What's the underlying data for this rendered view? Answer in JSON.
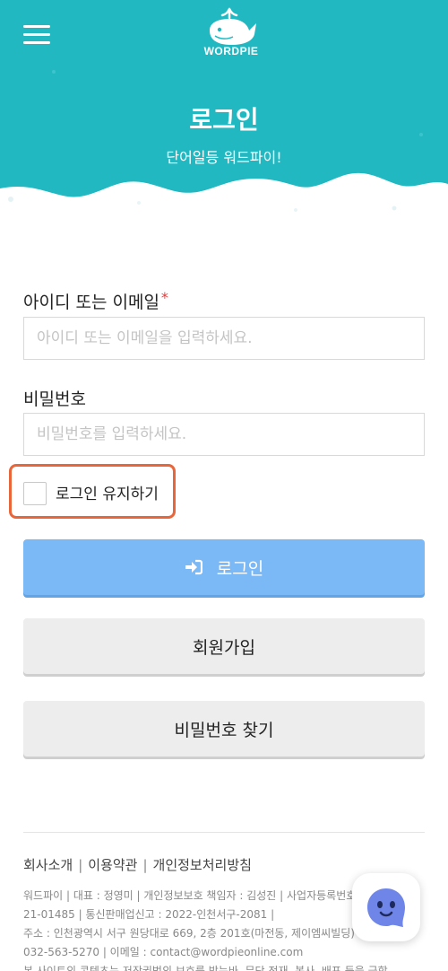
{
  "header": {
    "logo_text": "WORDPIE",
    "title": "로그인",
    "subtitle": "단어일등 워드파이!",
    "bg_color": "#22b8c2"
  },
  "form": {
    "id_label": "아이디 또는 이메일",
    "id_required_mark": "*",
    "id_placeholder": "아이디 또는 이메일을 입력하세요.",
    "password_label": "비밀번호",
    "password_placeholder": "비밀번호를 입력하세요.",
    "keep_login_label": "로그인 유지하기",
    "keep_login_checked": false
  },
  "buttons": {
    "login": "로그인",
    "signup": "회원가입",
    "find_password": "비밀번호 찾기"
  },
  "footer": {
    "links": [
      "회사소개",
      "이용약관",
      "개인정보처리방침"
    ],
    "info_lines": [
      "워드파이 | 대표 : 정영미 | 개인정보보호 책임자 : 김성진 | 사업자등록번호 : 1",
      "21-01485 | 통신판매업신고 : 2022-인천서구-2081 |",
      "주소 : 인천광역시 서구 원당대로 669, 2층 201호(마전동, 제이엠씨빌딩)",
      "032-563-5270 | 이메일 : contact@wordpieonline.com",
      "본 사이트의 콘텐츠는 저작권법의 보호를 받는바, 무단 전재, 복사, 배포 등을 금합"
    ]
  },
  "icons": {
    "menu": "hamburger-icon",
    "logo": "whale-logo-icon",
    "login": "sign-in-icon",
    "chat": "chatbot-icon"
  },
  "colors": {
    "accent": "#22b8c2",
    "login_button": "#7ab8f6",
    "highlight_box": "#e8663a",
    "required": "#e23b3b"
  }
}
